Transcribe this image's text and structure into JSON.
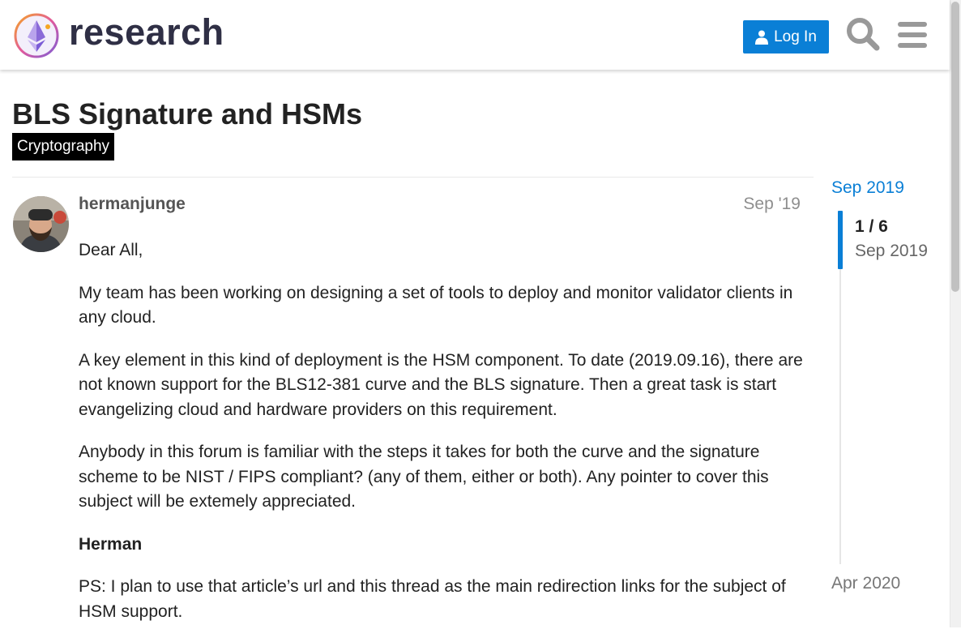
{
  "header": {
    "brand_text": "research",
    "login_label": "Log In",
    "logo_icon": "ethresear-ch-logo-icon",
    "search_icon": "search-icon",
    "menu_icon": "hamburger-menu-icon",
    "accent_color": "#0a7fd6"
  },
  "topic": {
    "title": "BLS Signature and HSMs",
    "category": "Cryptography",
    "category_color": "#000000"
  },
  "post": {
    "username": "hermanjunge",
    "date": "Sep '19",
    "paragraphs": [
      "Dear All,",
      "My team has been working on designing a set of tools to deploy and monitor validator clients in any cloud.",
      "A key element in this kind of deployment is the HSM component. To date (2019.09.16), there are not known support for the BLS12-381 curve and the BLS signature. Then a great task is start evangelizing cloud and hardware providers on this requirement.",
      "Anybody in this forum is familiar with the steps it takes for both the curve and the signature scheme to be NIST / FIPS compliant? (any of them, either or both). Any pointer to cover this subject will be extemely appreciated.",
      "Herman",
      "PS: I plan to use that article’s url and this thread as the main redirection links for the subject of HSM support."
    ]
  },
  "timeline": {
    "start_date": "Sep 2019",
    "progress": "1 / 6",
    "current_date": "Sep 2019",
    "end_date": "Apr 2020",
    "position_fraction": 0.0
  }
}
